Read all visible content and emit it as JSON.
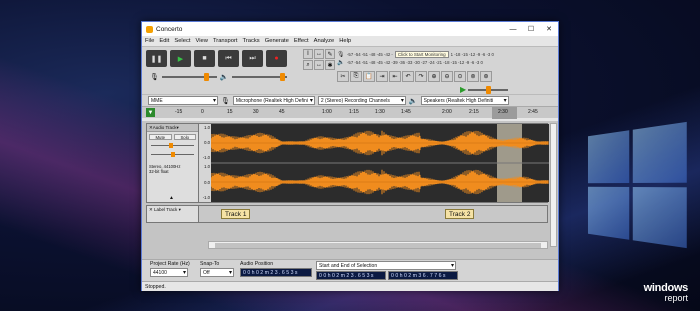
{
  "window": {
    "title": "Concerto"
  },
  "menu": [
    "File",
    "Edit",
    "Select",
    "View",
    "Transport",
    "Tracks",
    "Generate",
    "Effect",
    "Analyze",
    "Help"
  ],
  "meters": {
    "record_scale": "-57 -54 -51 -48 -45 -42 -",
    "monitor_label": "Click to Start Monitoring",
    "record_scale_right": "1 -18 -15 -12 -9 -6 -3 0",
    "play_scale": "-57 -54 -51 -48 -45 -42 -39 -36 -33 -30 -27 -24 -21 -18 -15 -12 -9 -6 -3 0"
  },
  "devices": {
    "host": "MME",
    "mic": "Microphone (Realtek High Defini",
    "channels": "2 (Stereo) Recording Channels",
    "speaker": "Speakers (Realtek High Definiti"
  },
  "timeline": [
    "-15",
    "0",
    "15",
    "30",
    "45",
    "1:00",
    "1:15",
    "1:30",
    "1:45",
    "2:00",
    "2:15",
    "2:30",
    "2:45"
  ],
  "audio_track": {
    "name": "Audio Track",
    "mute": "Mute",
    "solo": "Solo",
    "info": "Stereo, 44100Hz\n32-bit float",
    "scale": [
      "1.0",
      "0.0",
      "-1.0",
      "1.0",
      "0.0",
      "-1.0"
    ]
  },
  "label_track": {
    "name": "Label Track",
    "labels": [
      "Track 1",
      "Track 2"
    ]
  },
  "selection_toolbar": {
    "rate_label": "Project Rate (Hz)",
    "rate_value": "44100",
    "snap_label": "Snap-To",
    "snap_value": "Off",
    "audio_pos_label": "Audio Position",
    "audio_pos_value": "0 0 h 0 2 m 2 3 . 6 5 3 s",
    "sel_label": "Start and End of Selection",
    "sel_start": "0 0 h 0 2 m 2 3 . 6 5 3 s",
    "sel_end": "0 0 h 0 2 m 3 6 . 7 7 6 s"
  },
  "status": "Stopped.",
  "watermark": {
    "line1": "windows",
    "line2": "report"
  }
}
